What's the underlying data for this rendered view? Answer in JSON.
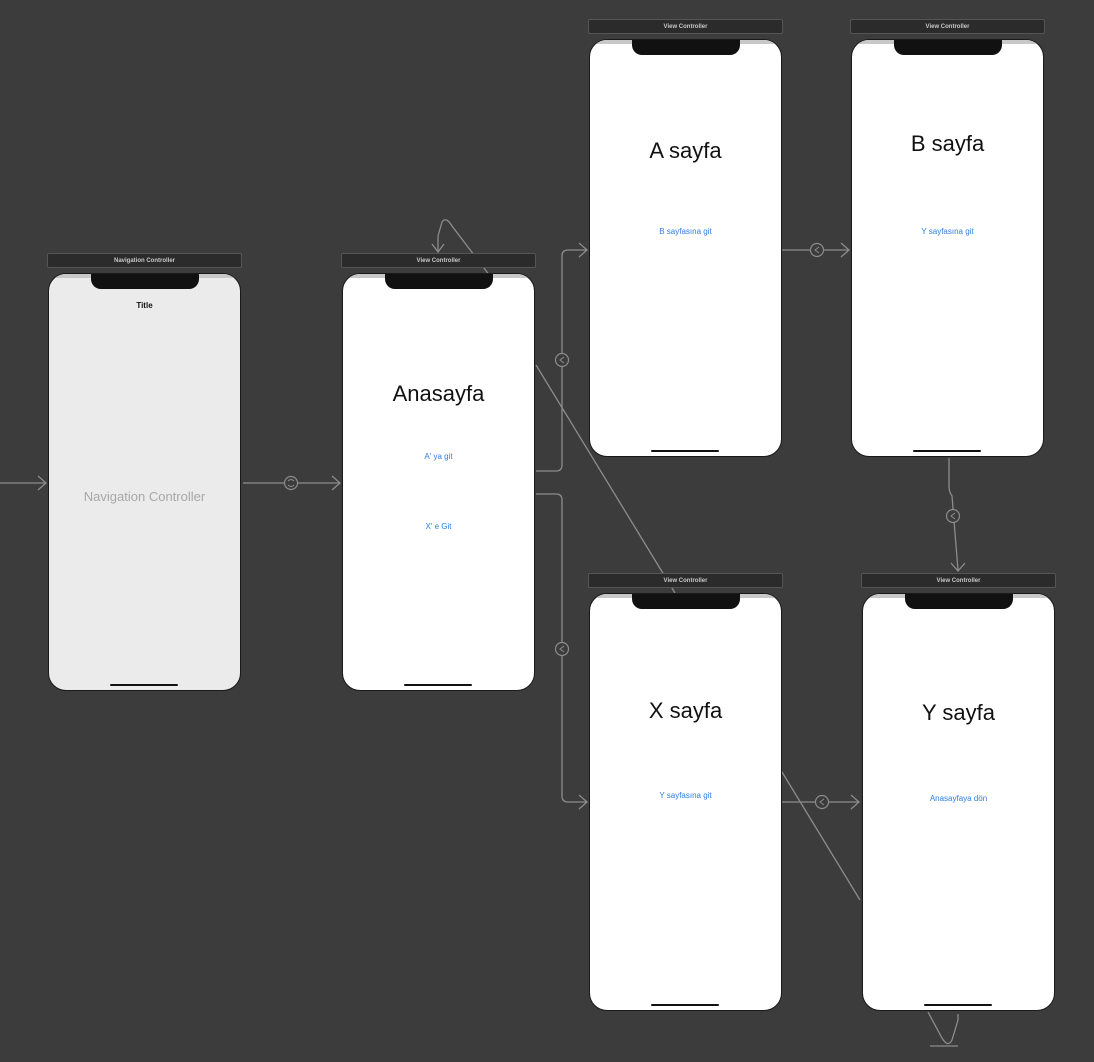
{
  "scenes": {
    "nav": {
      "bar_title": "Navigation Controller",
      "nav_title": "Title",
      "placeholder": "Navigation Controller"
    },
    "home": {
      "bar_title": "View Controller",
      "heading": "Anasayfa",
      "link_a": "A' ya git",
      "link_x": "X' e Git"
    },
    "a": {
      "bar_title": "View Controller",
      "heading": "A sayfa",
      "link": "B sayfasına git"
    },
    "b": {
      "bar_title": "View Controller",
      "heading": "B sayfa",
      "link": "Y sayfasına git"
    },
    "x": {
      "bar_title": "View Controller",
      "heading": "X sayfa",
      "link": "Y sayfasına git"
    },
    "y": {
      "bar_title": "View Controller",
      "heading": "Y sayfa",
      "link": "Anasayfaya dön"
    }
  },
  "colors": {
    "canvas": "#3c3c3c",
    "segue_line": "#8c8c8c",
    "link": "#2f7de1",
    "nav_background": "#ebebeb"
  }
}
